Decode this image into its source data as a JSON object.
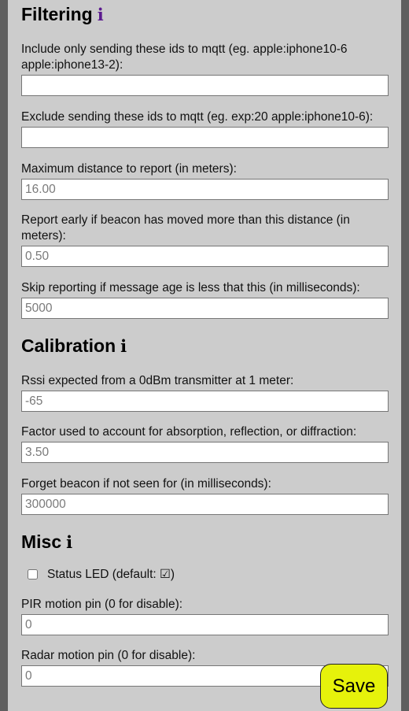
{
  "filtering": {
    "title": "Filtering",
    "info_icon": "i",
    "include": {
      "label": "Include only sending these ids to mqtt (eg. apple:iphone10-6 apple:iphone13-2):",
      "value": ""
    },
    "exclude": {
      "label": "Exclude sending these ids to mqtt (eg. exp:20 apple:iphone10-6):",
      "value": ""
    },
    "max_distance": {
      "label": "Maximum distance to report (in meters):",
      "value": "16.00"
    },
    "report_early": {
      "label": "Report early if beacon has moved more than this distance (in meters):",
      "value": "0.50"
    },
    "skip_reporting": {
      "label": "Skip reporting if message age is less that this (in milliseconds):",
      "value": "5000"
    }
  },
  "calibration": {
    "title": "Calibration",
    "info_icon": "i",
    "rssi": {
      "label": "Rssi expected from a 0dBm transmitter at 1 meter:",
      "value": "-65"
    },
    "factor": {
      "label": "Factor used to account for absorption, reflection, or diffraction:",
      "value": "3.50"
    },
    "forget": {
      "label": "Forget beacon if not seen for (in milliseconds):",
      "value": "300000"
    }
  },
  "misc": {
    "title": "Misc",
    "info_icon": "i",
    "status_led": {
      "label": "Status LED (default: ☑)",
      "checked": false
    },
    "pir_pin": {
      "label": "PIR motion pin (0 for disable):",
      "value": "0"
    },
    "radar_pin": {
      "label": "Radar motion pin (0 for disable):",
      "value": "0"
    }
  },
  "save_button": {
    "label": "Save",
    "color": "#e6f20b"
  },
  "colors": {
    "panel": "#cccccc",
    "page_background": "#5f5f5f",
    "filtering_icon": "#5b1a8f"
  }
}
